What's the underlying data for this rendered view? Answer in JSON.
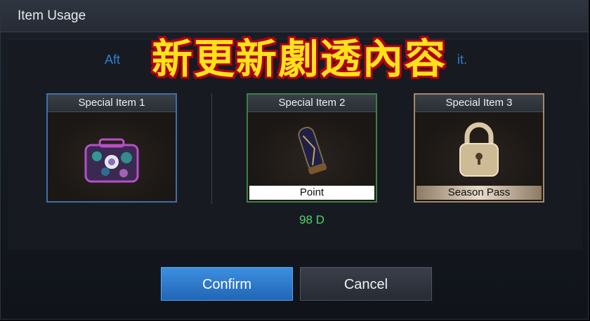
{
  "dialog": {
    "title": "Item Usage",
    "description_fragment": "Aft",
    "description_tail": "it.",
    "overlay_banner": "新更新劇透內容"
  },
  "items": [
    {
      "label": "Special Item 1",
      "footer": "",
      "icon": "treasure-chest-icon",
      "border_color": "#3f6fa8"
    },
    {
      "label": "Special Item 2",
      "footer": "Point",
      "icon": "scroll-vial-icon",
      "border_color": "#3d7f46"
    },
    {
      "label": "Special Item 3",
      "footer": "Season Pass",
      "icon": "padlock-icon",
      "border_color": "#a3896a"
    }
  ],
  "price": "98 D",
  "buttons": {
    "confirm": "Confirm",
    "cancel": "Cancel"
  },
  "colors": {
    "accent_blue": "#2f7fd0",
    "price_green": "#4fd36b",
    "banner_yellow": "#ffe21a",
    "banner_red": "#e2141e"
  }
}
